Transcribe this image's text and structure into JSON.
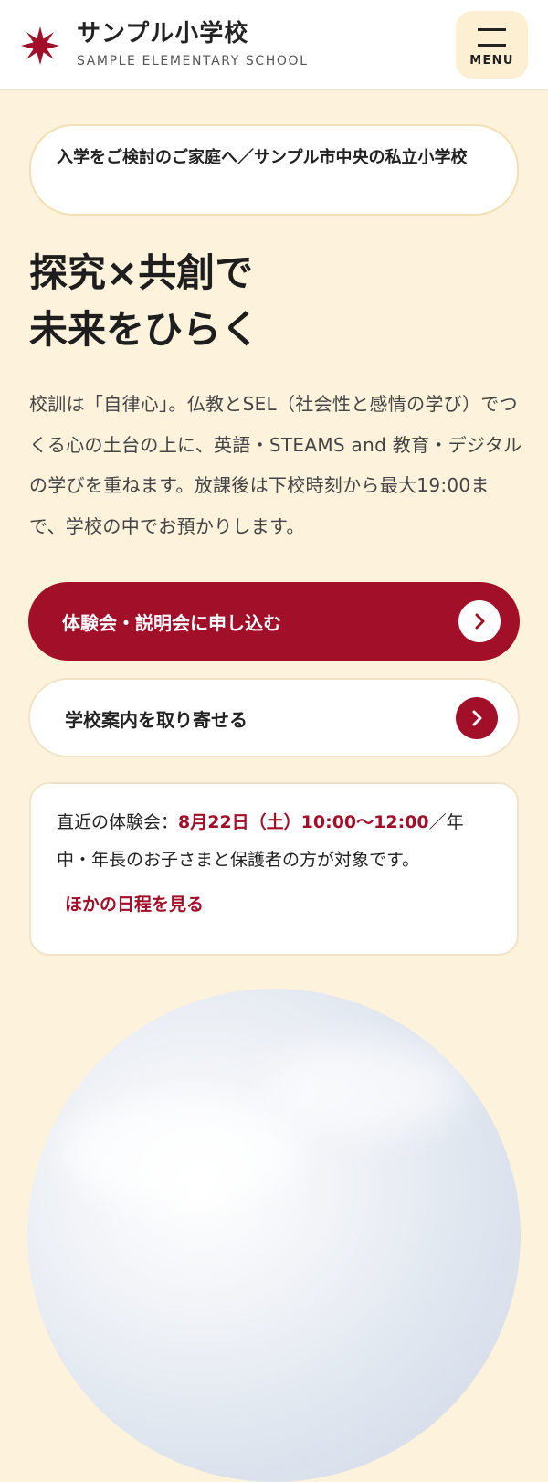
{
  "header": {
    "site_name": "サンプル小学校",
    "site_name_en": "SAMPLE ELEMENTARY SCHOOL",
    "menu_label": "MENU",
    "accent_color": "#a20f29"
  },
  "notice": {
    "text": "入学をご検討のご家庭へ／サンプル市中央の私立小学校"
  },
  "hero": {
    "title_line1": "探究×共創で",
    "title_line2": "未来をひらく",
    "description": "校訓は「自律心」。仏教とSEL（社会性と感情の学び）でつくる心の土台の上に、英語・STEAMS and 教育・デジタルの学びを重ねます。放課後は下校時刻から最大19:00まで、学校の中でお預かりします。"
  },
  "actions": {
    "primary_label": "体験会・説明会に申し込む",
    "secondary_label": "学校案内を取り寄せる",
    "arrow_icon": "chevron-right-icon"
  },
  "event": {
    "prefix": "直近の体験会：",
    "date": "8月22日（土）10:00〜12:00",
    "suffix": "／年中・年長のお子さまと保護者の方が対象です。",
    "link_label": "ほかの日程を見る"
  },
  "colors": {
    "background": "#fdf3dc",
    "primary": "#a20f29",
    "card": "#ffffff"
  }
}
